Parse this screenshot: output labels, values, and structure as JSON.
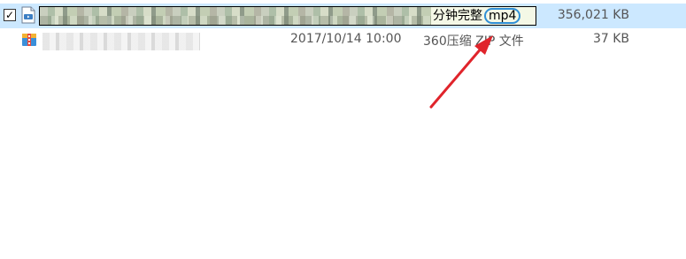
{
  "files": [
    {
      "selected": true,
      "checked": "✓",
      "icon": "video-file-icon",
      "rename_visible_text": "分钟完整",
      "rename_extension": "mp4",
      "size": "356,021 KB"
    },
    {
      "selected": false,
      "icon": "360-zip-file-icon",
      "date": "2017/10/14 10:00",
      "type": "360压缩 ZIP 文件",
      "size": "37 KB"
    }
  ],
  "colors": {
    "selection_bg": "#cce8ff",
    "annotation_arrow": "#e0242b",
    "highlight_circle": "#2f8fd6"
  }
}
